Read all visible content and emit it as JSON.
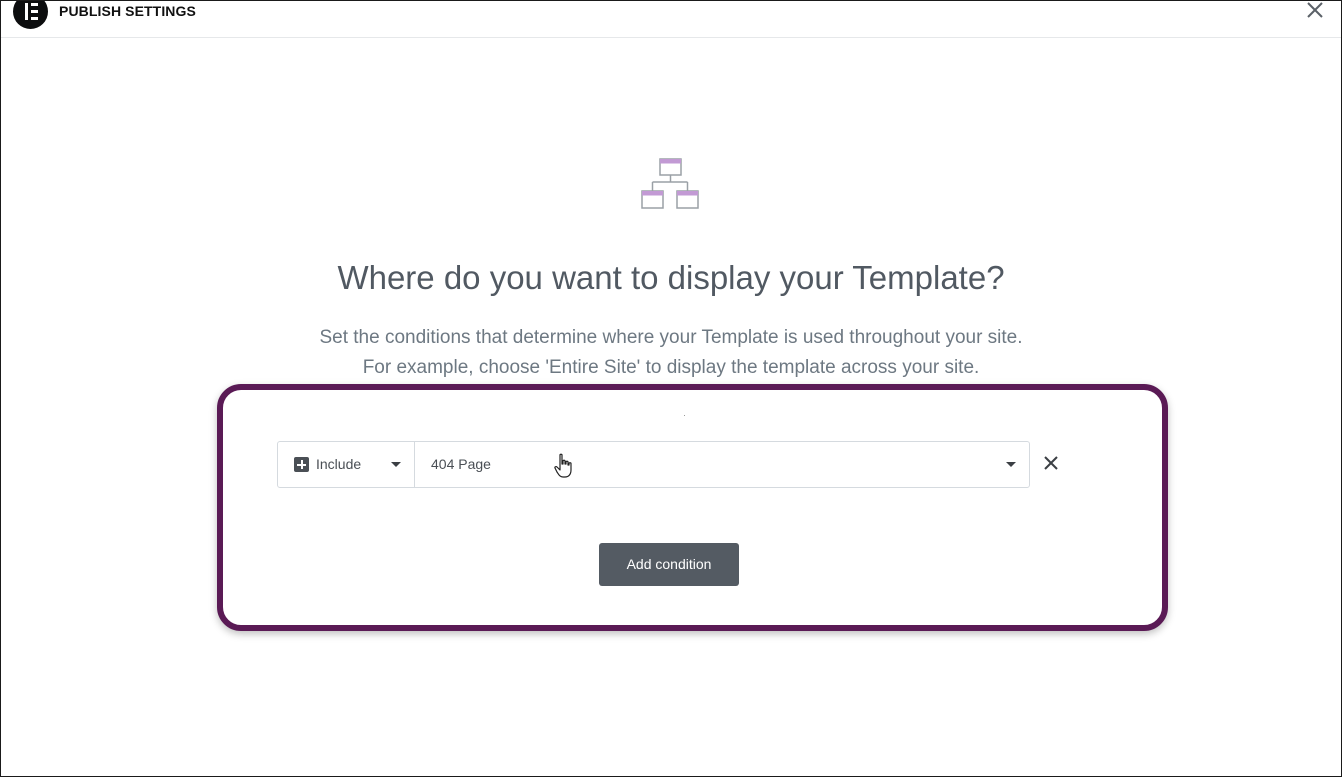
{
  "header": {
    "title": "PUBLISH SETTINGS",
    "logo_icon": "elementor-logo-icon",
    "close_icon": "close-icon"
  },
  "main": {
    "icon": "sitemap-hierarchy-icon",
    "heading": "Where do you want to display your Template?",
    "description_line1": "Set the conditions that determine where your Template is used throughout your site.",
    "description_line2": "For example, choose 'Entire Site' to display the template across your site."
  },
  "conditions": [
    {
      "type_value": "Include",
      "type_icon": "plus-square-icon",
      "page_value": "404 Page",
      "remove_icon": "close-icon"
    }
  ],
  "actions": {
    "add_condition_label": "Add condition"
  },
  "colors": {
    "highlight_border": "#5a1a55",
    "icon_accent": "#c29ad4",
    "icon_stroke": "#9aa0a6",
    "button_bg": "#545b63",
    "heading_text": "#515962",
    "body_text": "#6d7882"
  }
}
